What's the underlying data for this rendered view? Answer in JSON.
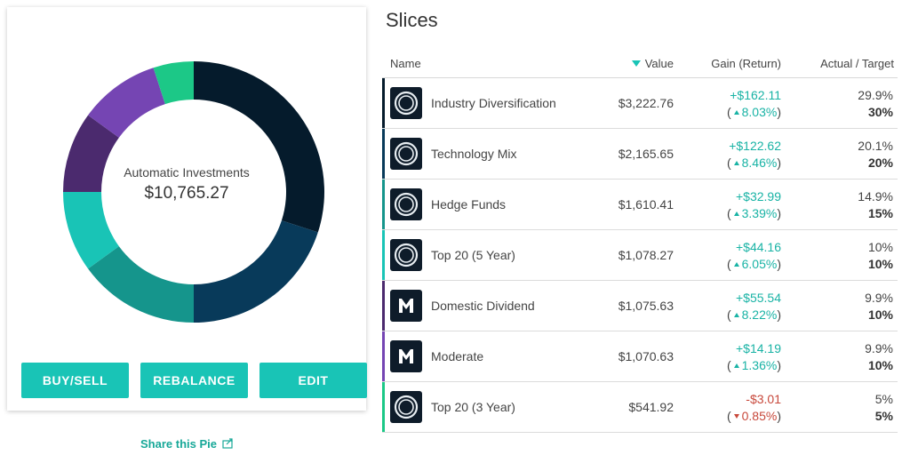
{
  "pie": {
    "title": "Automatic Investments",
    "total": "$10,765.27"
  },
  "buttons": {
    "buy_sell": "BUY/SELL",
    "rebalance": "REBALANCE",
    "edit": "EDIT"
  },
  "share": {
    "label": "Share this Pie"
  },
  "slices": {
    "title": "Slices",
    "headers": {
      "name": "Name",
      "value": "Value",
      "gain": "Gain (Return)",
      "actual_target": "Actual / Target"
    },
    "rows": [
      {
        "name": "Industry Diversification",
        "value": "$3,222.76",
        "gain": "+$162.11",
        "gain_pct": "8.03%",
        "direction": "up",
        "actual": "29.9%",
        "target": "30%",
        "logo": "circle-logo-icon",
        "color": "#051b2c"
      },
      {
        "name": "Technology Mix",
        "value": "$2,165.65",
        "gain": "+$122.62",
        "gain_pct": "8.46%",
        "direction": "up",
        "actual": "20.1%",
        "target": "20%",
        "logo": "circle-logo-icon",
        "color": "#083a5a"
      },
      {
        "name": "Hedge Funds",
        "value": "$1,610.41",
        "gain": "+$32.99",
        "gain_pct": "3.39%",
        "direction": "up",
        "actual": "14.9%",
        "target": "15%",
        "logo": "circle-logo-icon",
        "color": "#15958c"
      },
      {
        "name": "Top 20 (5 Year)",
        "value": "$1,078.27",
        "gain": "+$44.16",
        "gain_pct": "6.05%",
        "direction": "up",
        "actual": "10%",
        "target": "10%",
        "logo": "circle-logo-icon",
        "color": "#19c4b6"
      },
      {
        "name": "Domestic Dividend",
        "value": "$1,075.63",
        "gain": "+$55.54",
        "gain_pct": "8.22%",
        "direction": "up",
        "actual": "9.9%",
        "target": "10%",
        "logo": "m-logo-icon",
        "color": "#4b2a6e"
      },
      {
        "name": "Moderate",
        "value": "$1,070.63",
        "gain": "+$14.19",
        "gain_pct": "1.36%",
        "direction": "up",
        "actual": "9.9%",
        "target": "10%",
        "logo": "m-logo-icon",
        "color": "#7545b3"
      },
      {
        "name": "Top 20 (3 Year)",
        "value": "$541.92",
        "gain": "-$3.01",
        "gain_pct": "0.85%",
        "direction": "down",
        "actual": "5%",
        "target": "5%",
        "logo": "circle-logo-icon",
        "color": "#1cc887"
      }
    ]
  },
  "colors": {
    "accent": "#19c4b6",
    "positive": "#19b3a5",
    "negative": "#c8483b"
  }
}
